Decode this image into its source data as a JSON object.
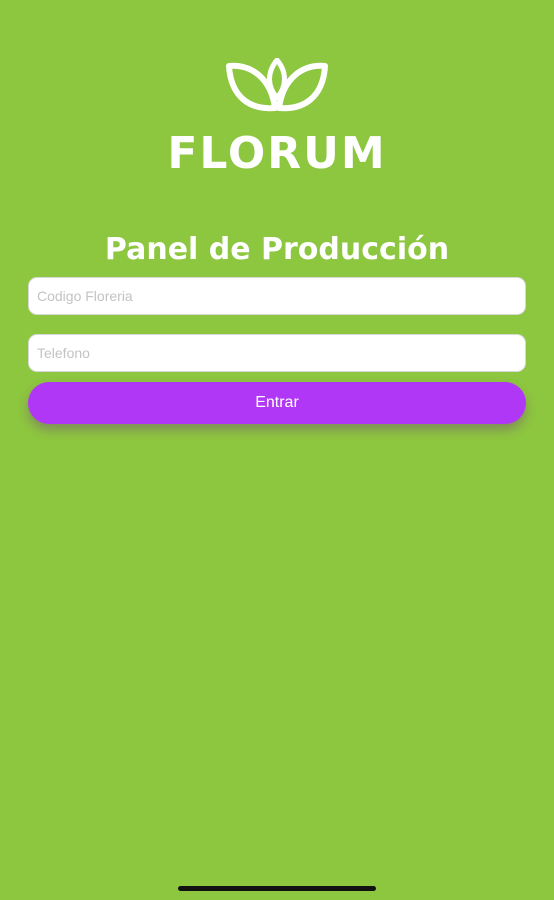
{
  "brand": {
    "logo_icon": "lotus-leaves-icon",
    "wordmark": "FLORUM"
  },
  "page": {
    "title": "Panel de Producción"
  },
  "form": {
    "code_placeholder": "Codigo Floreria",
    "code_value": "",
    "phone_placeholder": "Telefono",
    "phone_value": "",
    "submit_label": "Entrar"
  },
  "colors": {
    "background": "#8dc63f",
    "button": "#b137f7",
    "text_light": "#ffffff",
    "placeholder": "#c3c3c3"
  }
}
